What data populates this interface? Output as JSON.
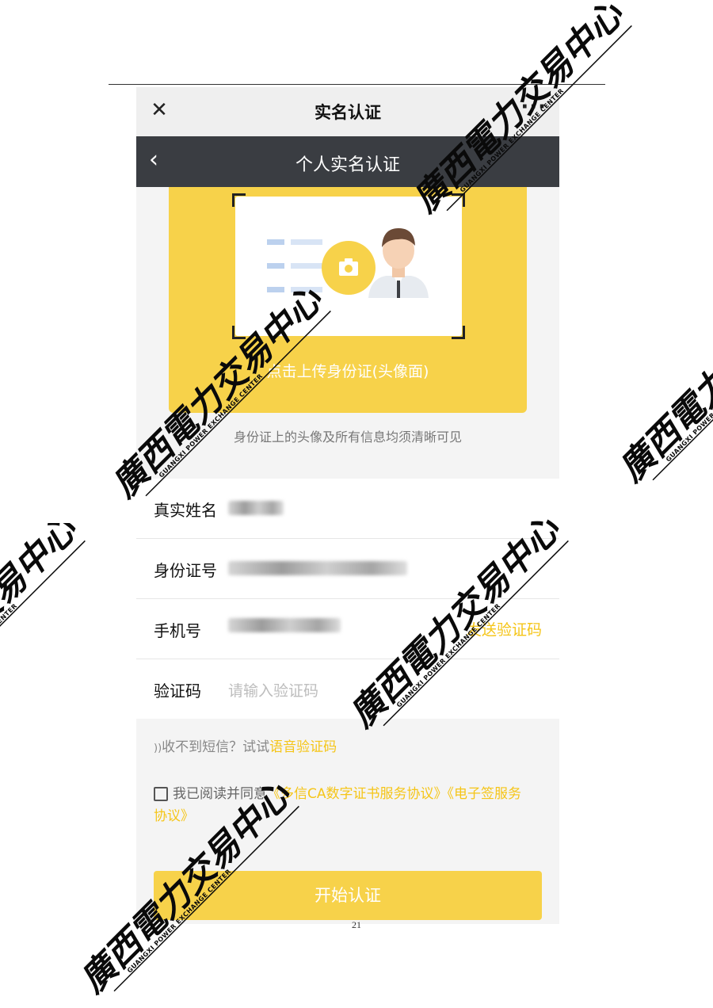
{
  "wechat_bar": {
    "close_icon": "close-icon",
    "title": "实名认证",
    "more_icon": "more-icon",
    "more_glyph": "···"
  },
  "nav": {
    "back_icon": "chevron-left-icon",
    "title": "个人实名认证"
  },
  "upload": {
    "label": "点击上传身份证(头像面)",
    "hint": "身份证上的头像及所有信息均须清晰可见",
    "camera_icon": "camera-icon"
  },
  "form": {
    "name_label": "真实姓名",
    "id_label": "身份证号",
    "phone_label": "手机号",
    "send_code": "发送验证码",
    "code_label": "验证码",
    "code_placeholder": "请输入验证码"
  },
  "voice": {
    "icon": "sound-icon",
    "glyph": "))",
    "prefix": "收不到短信？试试",
    "link": "语音验证码"
  },
  "agreement": {
    "prefix": "我已阅读并同意",
    "links": "《多信CA数字证书服务协议》《电子签服务协议》"
  },
  "start_button": "开始认证",
  "page_number": "21",
  "watermark": {
    "chinese": "廣西電力交易中心",
    "english": "GUANGXI POWER EXCHANGE CENTER"
  },
  "colors": {
    "accent": "#f7d24a",
    "link": "#f5c518",
    "nav_bg": "#3a3d42"
  }
}
